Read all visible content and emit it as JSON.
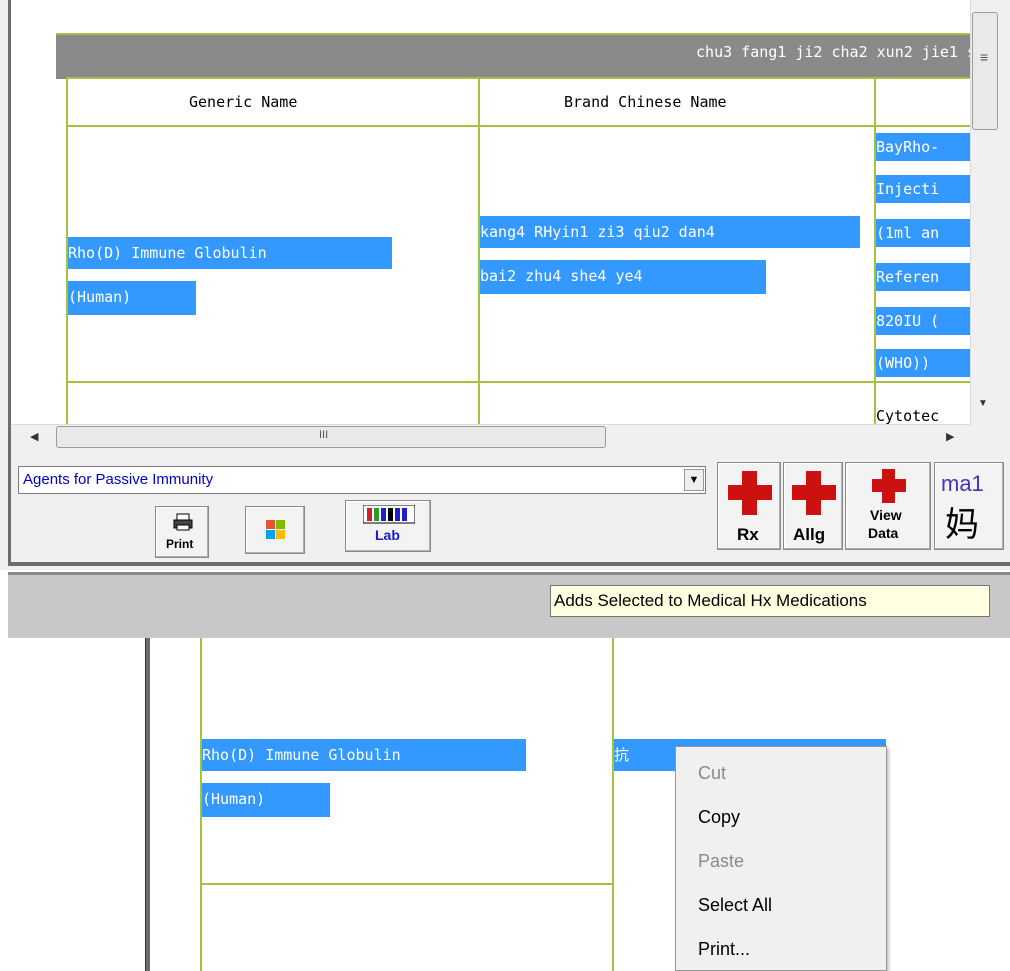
{
  "table": {
    "header_title": "chu3 fang1 ji2 cha2 xun2 jie1 s",
    "columns": [
      "Generic Name",
      "Brand Chinese Name"
    ],
    "row1": {
      "generic_line1": "Rho(D) Immune Globulin",
      "generic_line2": "(Human)",
      "brand_line1": "kang4 RHyin1 zi3 qiu2 dan4",
      "brand_line2": "bai2 zhu4 she4 ye4",
      "extra_lines": [
        "BayRho-",
        "Injecti",
        "(1ml an",
        "Referen",
        "820IU (",
        "(WHO))"
      ]
    },
    "row2": {
      "extra_line1": "Cytotec"
    }
  },
  "scrollbar": {
    "h_grip": "III",
    "v_grip": "≡"
  },
  "toolbar": {
    "category_value": "Agents for Passive Immunity",
    "print_label": "Print",
    "lab_label": "Lab",
    "rx_label": "Rx",
    "allg_label": "Allg",
    "view_label": "View",
    "data_label": "Data",
    "pinyin_label": "ma1",
    "hanzi_label": "妈"
  },
  "tooltip": {
    "text": "Adds Selected to Medical Hx Medications"
  },
  "lower": {
    "generic_line1": "Rho(D) Immune Globulin",
    "generic_line2": "(Human)",
    "brand_fragment": "抗"
  },
  "context_menu": {
    "items": [
      {
        "label": "Cut",
        "enabled": false
      },
      {
        "label": "Copy",
        "enabled": true
      },
      {
        "label": "Paste",
        "enabled": false
      },
      {
        "label": "Select All",
        "enabled": true
      },
      {
        "label": "Print...",
        "enabled": true
      }
    ]
  },
  "colors": {
    "selection": "#3399ff",
    "table_border": "#a5c23f",
    "header_bar": "#8a8a8a",
    "tooltip_bg": "#ffffe1",
    "combo_text": "#0000cc",
    "red_cross": "#cc1111"
  }
}
